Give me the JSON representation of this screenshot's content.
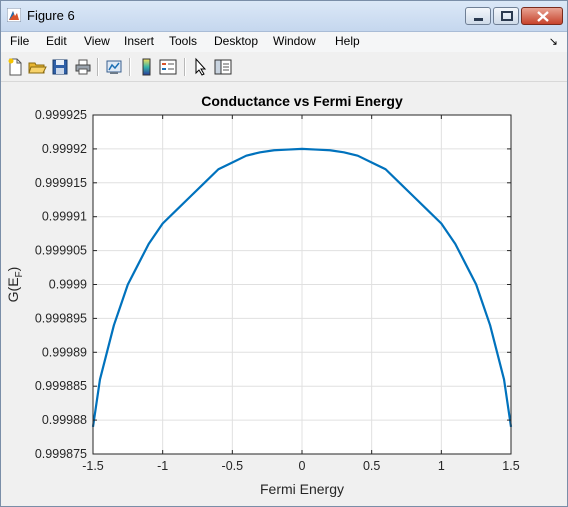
{
  "window": {
    "title": "Figure 6"
  },
  "menu": {
    "items": [
      "File",
      "Edit",
      "View",
      "Insert",
      "Tools",
      "Desktop",
      "Window",
      "Help"
    ],
    "overflow_icon": "curved-arrow-icon"
  },
  "toolbar": {
    "buttons": [
      {
        "name": "new-figure",
        "icon": "new-document-icon"
      },
      {
        "name": "open-file",
        "icon": "folder-open-icon"
      },
      {
        "name": "save-figure",
        "icon": "floppy-disk-icon"
      },
      {
        "name": "print-figure",
        "icon": "printer-icon"
      },
      {
        "name": "link-plot",
        "icon": "link-plot-icon"
      },
      {
        "name": "insert-colorbar",
        "icon": "colorbar-icon"
      },
      {
        "name": "insert-legend",
        "icon": "legend-icon"
      },
      {
        "name": "edit-plot",
        "icon": "pointer-arrow-icon"
      },
      {
        "name": "property-inspector",
        "icon": "property-panel-icon"
      }
    ]
  },
  "colors": {
    "line": "#0072bd",
    "axes_bg": "#ffffff",
    "grid": "#e0e0e0",
    "figure_bg": "#f0f0f0"
  },
  "chart_data": {
    "type": "line",
    "title": "Conductance vs Fermi Energy",
    "xlabel": "Fermi Energy",
    "ylabel_main": "G(E",
    "ylabel_sub": "F",
    "ylabel_close": ")",
    "xlim": [
      -1.5,
      1.5
    ],
    "ylim": [
      0.999875,
      0.999925
    ],
    "xticks": [
      -1.5,
      -1,
      -0.5,
      0,
      0.5,
      1,
      1.5
    ],
    "xtick_labels": [
      "-1.5",
      "-1",
      "-0.5",
      "0",
      "0.5",
      "1",
      "1.5"
    ],
    "yticks": [
      0.999875,
      0.99988,
      0.999885,
      0.99989,
      0.999895,
      0.9999,
      0.999905,
      0.99991,
      0.999915,
      0.99992,
      0.999925
    ],
    "ytick_labels": [
      "0.999875",
      "0.99988",
      "0.999885",
      "0.99989",
      "0.999895",
      "0.9999",
      "0.999905",
      "0.99991",
      "0.999915",
      "0.99992",
      "0.999925"
    ],
    "grid": true,
    "series": [
      {
        "x": [
          -1.5,
          -1.45,
          -1.4,
          -1.35,
          -1.3,
          -1.25,
          -1.2,
          -1.1,
          -1.0,
          -0.9,
          -0.8,
          -0.7,
          -0.6,
          -0.5,
          -0.4,
          -0.3,
          -0.2,
          -0.1,
          0,
          0.1,
          0.2,
          0.3,
          0.4,
          0.5,
          0.6,
          0.7,
          0.8,
          0.9,
          1.0,
          1.1,
          1.2,
          1.25,
          1.3,
          1.35,
          1.4,
          1.45,
          1.5
        ],
        "y": [
          0.999879,
          0.999886,
          0.99989,
          0.999894,
          0.999897,
          0.9999,
          0.999902,
          0.999906,
          0.999909,
          0.999911,
          0.999913,
          0.999915,
          0.999917,
          0.999918,
          0.999919,
          0.9999195,
          0.9999198,
          0.9999199,
          0.99992,
          0.9999199,
          0.9999198,
          0.9999195,
          0.999919,
          0.999918,
          0.999917,
          0.999915,
          0.999913,
          0.999911,
          0.999909,
          0.999906,
          0.999902,
          0.9999,
          0.999897,
          0.999894,
          0.99989,
          0.999886,
          0.999879
        ]
      }
    ]
  }
}
